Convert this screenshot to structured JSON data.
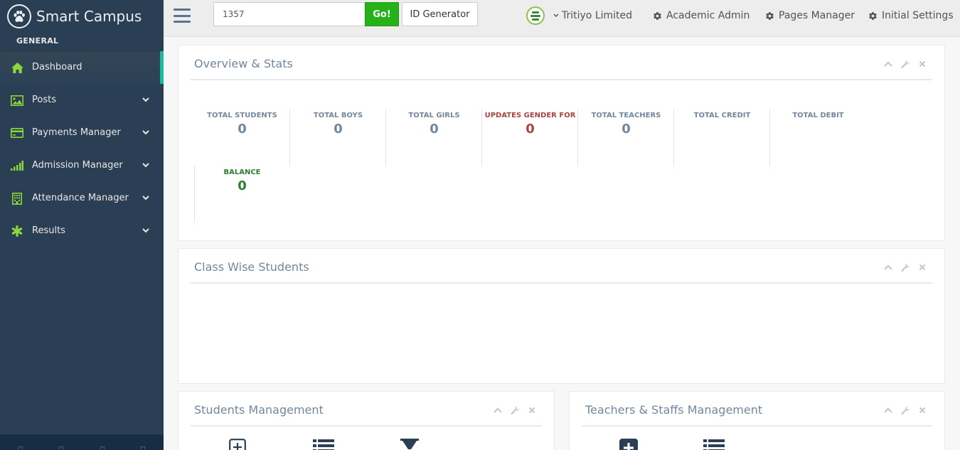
{
  "sidebar": {
    "brand": "Smart Campus",
    "section": "GENERAL",
    "items": [
      {
        "label": "Dashboard",
        "icon": "home-icon",
        "active": true
      },
      {
        "label": "Posts",
        "icon": "image-icon"
      },
      {
        "label": "Payments Manager",
        "icon": "credit-card-icon"
      },
      {
        "label": "Admission Manager",
        "icon": "signal-icon"
      },
      {
        "label": "Attendance Manager",
        "icon": "building-icon"
      },
      {
        "label": "Results",
        "icon": "asterisk-icon"
      }
    ]
  },
  "topnav": {
    "search_value": "1357",
    "go_label": "Go!",
    "id_generator_label": "ID Generator",
    "org_name": "Tritiyo Limited",
    "academic_admin": "Academic Admin",
    "pages_manager": "Pages Manager",
    "initial_settings": "Initial Settings"
  },
  "overview": {
    "title": "Overview & Stats",
    "stats": [
      {
        "label": "TOTAL STUDENTS",
        "value": "0"
      },
      {
        "label": "TOTAL BOYS",
        "value": "0"
      },
      {
        "label": "TOTAL GIRLS",
        "value": "0"
      },
      {
        "label": "UPDATES GENDER FOR",
        "value": "0"
      },
      {
        "label": "TOTAL TEACHERS",
        "value": "0"
      },
      {
        "label": "TOTAL CREDIT",
        "value": ""
      },
      {
        "label": "TOTAL DEBIT",
        "value": ""
      },
      {
        "label": "BALANCE",
        "value": "0"
      }
    ]
  },
  "class_wise": {
    "title": "Class Wise Students"
  },
  "students_mgmt": {
    "title": "Students Management"
  },
  "teachers_mgmt": {
    "title": "Teachers & Staffs Management"
  },
  "colors": {
    "sidebar_bg": "#2a3f54",
    "accent_green": "#26b11a",
    "active_bar": "#1abb9c",
    "icon_green": "#8bd63a",
    "red_stat": "#a94442",
    "green_stat": "#2e7d32"
  }
}
